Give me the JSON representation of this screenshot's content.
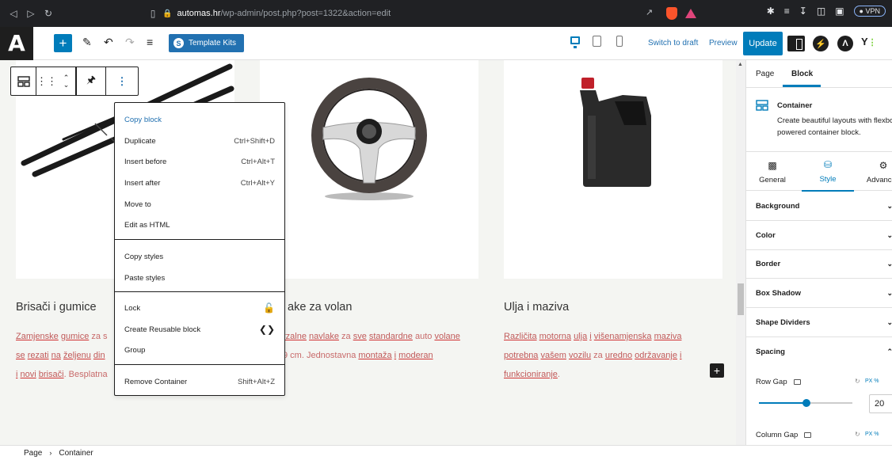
{
  "browser": {
    "url_host": "automas.hr",
    "url_path": "/wp-admin/post.php?post=1322&action=edit",
    "vpn_label": "● VPN"
  },
  "header": {
    "logo": "A",
    "template_kits_label": "Template Kits",
    "switch_to_draft": "Switch to draft",
    "preview": "Preview",
    "update": "Update"
  },
  "cards": [
    {
      "title": "Brisači i gumice",
      "desc_lines": [
        [
          [
            "u",
            "Zamjenske"
          ],
          [
            "n",
            " "
          ],
          [
            "u",
            "gumice"
          ],
          [
            "n",
            " za s"
          ]
        ],
        [
          [
            "u",
            "se"
          ],
          [
            "n",
            " "
          ],
          [
            "u",
            "rezati"
          ],
          [
            "n",
            " "
          ],
          [
            "u",
            "na"
          ],
          [
            "n",
            " "
          ],
          [
            "u",
            "željenu"
          ],
          [
            "n",
            " "
          ],
          [
            "u",
            "din"
          ]
        ],
        [
          [
            "u",
            "i"
          ],
          [
            "n",
            " "
          ],
          [
            "u",
            "novi"
          ],
          [
            "n",
            " "
          ],
          [
            "u",
            "brisači"
          ],
          [
            "n",
            ". Besplatna"
          ]
        ]
      ]
    },
    {
      "title": "ake za volan",
      "desc_lines": [
        [
          [
            "n",
            ""
          ],
          [
            "u",
            "rzalne"
          ],
          [
            "n",
            " "
          ],
          [
            "u",
            "navlake"
          ],
          [
            "n",
            " za "
          ],
          [
            "u",
            "sve"
          ],
          [
            "n",
            " "
          ],
          [
            "u",
            "standardne"
          ],
          [
            "n",
            " auto "
          ],
          [
            "u",
            "volane"
          ]
        ],
        [
          [
            "n",
            "9 cm. Jednostavna "
          ],
          [
            "u",
            "montaža"
          ],
          [
            "n",
            " "
          ],
          [
            "u",
            "i"
          ],
          [
            "n",
            " "
          ],
          [
            "u",
            "moderan"
          ]
        ],
        [
          [
            "n",
            "."
          ]
        ]
      ]
    },
    {
      "title": "Ulja i maziva",
      "desc_lines": [
        [
          [
            "u",
            "Različita"
          ],
          [
            "n",
            " "
          ],
          [
            "u",
            "motorna"
          ],
          [
            "n",
            " "
          ],
          [
            "u",
            "ulja"
          ],
          [
            "n",
            " "
          ],
          [
            "u",
            "i"
          ],
          [
            "n",
            " "
          ],
          [
            "u",
            "višenamjenska"
          ],
          [
            "n",
            " "
          ],
          [
            "u",
            "maziva"
          ]
        ],
        [
          [
            "u",
            "potrebna"
          ],
          [
            "n",
            " "
          ],
          [
            "u",
            "vašem"
          ],
          [
            "n",
            " "
          ],
          [
            "u",
            "vozilu"
          ],
          [
            "n",
            " za "
          ],
          [
            "u",
            "uredno"
          ],
          [
            "n",
            " "
          ],
          [
            "u",
            "održavanje"
          ],
          [
            "n",
            " "
          ],
          [
            "u",
            "i"
          ]
        ],
        [
          [
            "u",
            "funkcioniranje"
          ],
          [
            "n",
            "."
          ]
        ]
      ]
    }
  ],
  "context_menu": {
    "group1": [
      {
        "label": "Copy block",
        "shortcut": ""
      },
      {
        "label": "Duplicate",
        "shortcut": "Ctrl+Shift+D"
      },
      {
        "label": "Insert before",
        "shortcut": "Ctrl+Alt+T"
      },
      {
        "label": "Insert after",
        "shortcut": "Ctrl+Alt+Y"
      },
      {
        "label": "Move to",
        "shortcut": ""
      },
      {
        "label": "Edit as HTML",
        "shortcut": ""
      }
    ],
    "group2": [
      {
        "label": "Copy styles"
      },
      {
        "label": "Paste styles"
      }
    ],
    "group3": [
      {
        "label": "Lock",
        "icon": "lock-icon"
      },
      {
        "label": "Create Reusable block",
        "icon": "reusable-block-icon"
      },
      {
        "label": "Group"
      }
    ],
    "group4": [
      {
        "label": "Remove Container",
        "shortcut": "Shift+Alt+Z"
      }
    ]
  },
  "sidebar": {
    "tabs": [
      "Page",
      "Block"
    ],
    "block_name": "Container",
    "block_desc": "Create beautiful layouts with flexbox powered container block.",
    "subtabs": [
      "General",
      "Style",
      "Advanced"
    ],
    "panels": [
      "Background",
      "Color",
      "Border",
      "Box Shadow",
      "Shape Dividers",
      "Spacing"
    ],
    "row_gap_label": "Row Gap",
    "row_gap_value": "20",
    "row_gap_fill": 0.51,
    "column_gap_label": "Column Gap",
    "unit_label": "PX %"
  },
  "footer": {
    "crumbs": [
      "Page",
      "Container"
    ]
  }
}
